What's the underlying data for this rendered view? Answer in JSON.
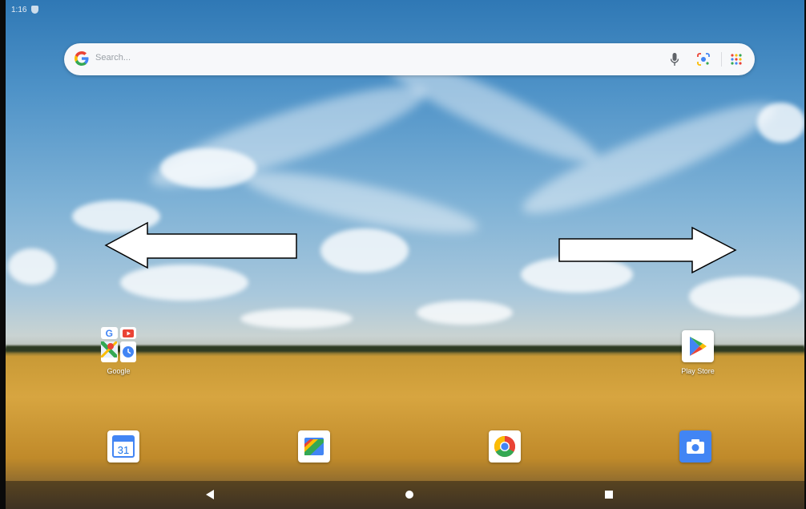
{
  "status_bar": {
    "time": "1:16"
  },
  "search": {
    "placeholder": "Search..."
  },
  "apps": {
    "google_folder": {
      "label": "Google"
    },
    "play_store": {
      "label": "Play Store"
    },
    "calendar": {
      "label": "",
      "day": "31"
    }
  },
  "icons": {
    "search_bar": [
      "google-g-icon",
      "mic-icon",
      "lens-icon",
      "app-grid-icon"
    ],
    "dock": [
      "calendar-icon",
      "files-icon",
      "chrome-icon",
      "camera-icon"
    ],
    "navigation": [
      "back-icon",
      "home-icon",
      "recents-icon"
    ],
    "overlay": [
      "left-arrow-icon",
      "right-arrow-icon"
    ]
  },
  "colors": {
    "sky": "#4f93c8",
    "field": "#d7a540",
    "search_bg": "#f7f8fa",
    "google_blue": "#4285f4",
    "google_red": "#ea4335",
    "google_yellow": "#fbbc05",
    "google_green": "#34a853"
  }
}
